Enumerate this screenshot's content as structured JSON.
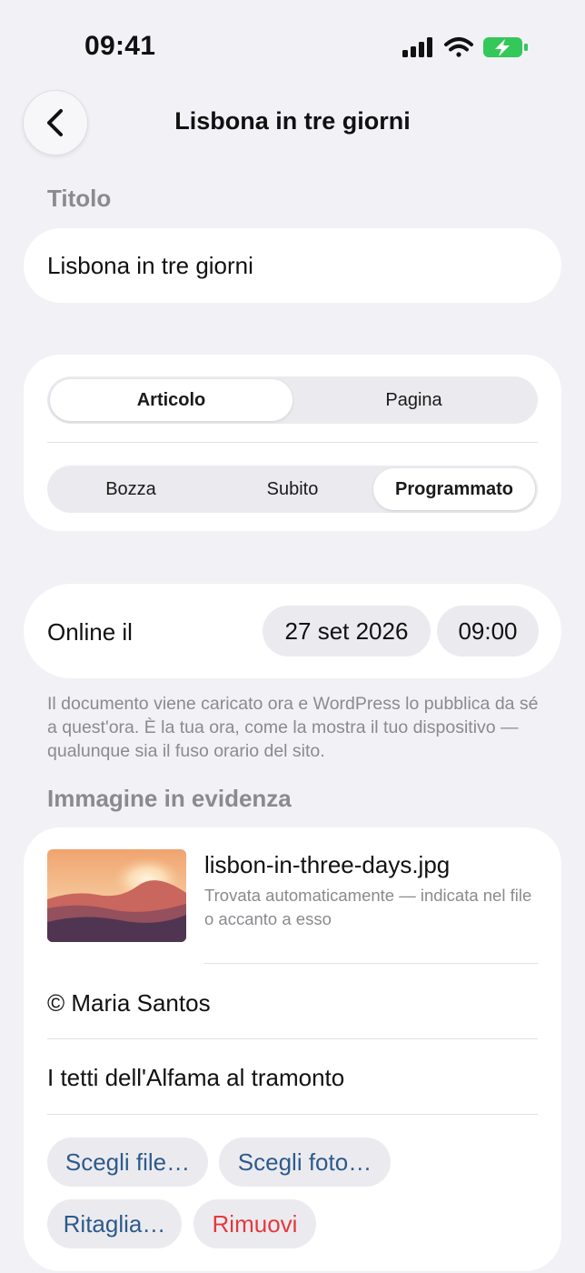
{
  "status_bar": {
    "time": "09:41"
  },
  "nav": {
    "title": "Lisbona in tre giorni"
  },
  "title_section": {
    "label": "Titolo",
    "value": "Lisbona in tre giorni"
  },
  "type_segment": {
    "options": [
      "Articolo",
      "Pagina"
    ],
    "selected": "Articolo"
  },
  "publish_segment": {
    "options": [
      "Bozza",
      "Subito",
      "Programmato"
    ],
    "selected": "Programmato"
  },
  "schedule": {
    "label": "Online il",
    "date": "27 set 2026",
    "time": "09:00",
    "note": "Il documento viene caricato ora e WordPress lo pubblica da sé a quest'ora. È la tua ora, come la mostra il tuo dispositivo — qualunque sia il fuso orario del sito."
  },
  "featured_image": {
    "section_label": "Immagine in evidenza",
    "file_name": "lisbon-in-three-days.jpg",
    "file_desc": "Trovata automaticamente — indicata nel file o accanto a esso",
    "credit": "© Maria Santos",
    "caption": "I tetti dell'Alfama al tramonto",
    "buttons": {
      "choose_file": "Scegli file…",
      "choose_photo": "Scegli foto…",
      "crop": "Ritaglia…",
      "remove": "Rimuovi"
    }
  },
  "colors": {
    "background": "#F1F1F6",
    "accent": "#2E5A8C",
    "destructive": "#E5393E",
    "battery": "#34C759"
  }
}
